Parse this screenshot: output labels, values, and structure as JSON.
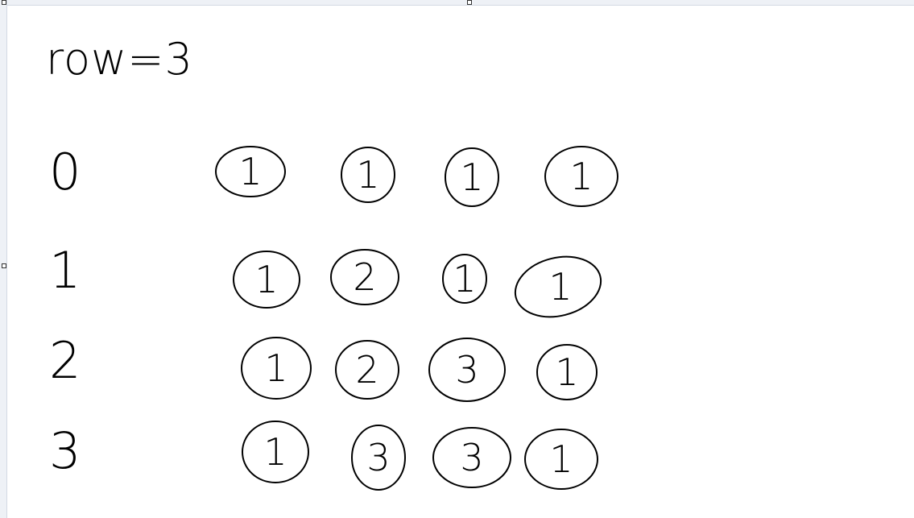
{
  "header": {
    "title": "row=3"
  },
  "rows": [
    {
      "label": "0",
      "cells": [
        "1",
        "1",
        "1",
        "1"
      ]
    },
    {
      "label": "1",
      "cells": [
        "1",
        "2",
        "1",
        "1"
      ]
    },
    {
      "label": "2",
      "cells": [
        "1",
        "2",
        "3",
        "1"
      ]
    },
    {
      "label": "3",
      "cells": [
        "1",
        "3",
        "3",
        "1"
      ]
    }
  ]
}
